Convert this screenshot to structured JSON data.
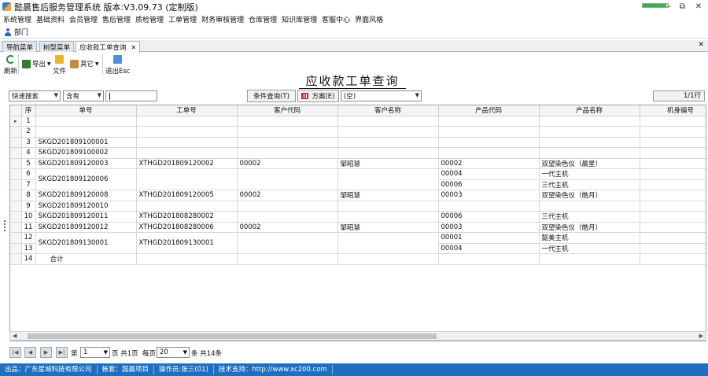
{
  "window": {
    "title": "懿晨售后服务管理系统 版本:V3.09.73 (定制版)",
    "progress": 0.95,
    "controls": {
      "minimize": "–",
      "restore": "⧉",
      "close": "✕"
    }
  },
  "menu": [
    "系统管理",
    "基础资料",
    "会员管理",
    "售后管理",
    "质检管理",
    "工单管理",
    "财务审核管理",
    "仓库管理",
    "知识库管理",
    "客服中心",
    "界面风格"
  ],
  "dept": {
    "label": "部门"
  },
  "tabs": [
    {
      "label": "导航菜单",
      "active": false
    },
    {
      "label": "树型菜单",
      "active": false
    },
    {
      "label": "应收款工单查询",
      "active": true,
      "close": "✕"
    }
  ],
  "panel_close": "✕",
  "toolbar": {
    "refresh": "刷新",
    "export": "导出",
    "file": "文件",
    "other": "其它",
    "exit": "退出Esc"
  },
  "page_title": "应收款工单查询",
  "filter": {
    "search_type": "快速搜索",
    "match": "含有",
    "keyword": "",
    "query_button": "条件查询(T)",
    "plan_button": "方案(E)",
    "plan_value": "(空)",
    "page_count": "1/1行"
  },
  "grid": {
    "columns": [
      "序",
      "单号",
      "工单号",
      "客户代码",
      "客户名称",
      "产品代码",
      "产品名称",
      "机身编号"
    ],
    "rows": [
      {
        "seq": "1",
        "order": "",
        "work": "",
        "cust_code": "",
        "cust_name": "",
        "prod_code": "",
        "prod_name": "",
        "serial": "",
        "current": true
      },
      {
        "seq": "2",
        "order": "",
        "work": "",
        "cust_code": "",
        "cust_name": "",
        "prod_code": "",
        "prod_name": "",
        "serial": ""
      },
      {
        "seq": "3",
        "order": "SKGD201809100001",
        "work": "",
        "cust_code": "",
        "cust_name": "",
        "prod_code": "",
        "prod_name": "",
        "serial": ""
      },
      {
        "seq": "4",
        "order": "SKGD201809100002",
        "work": "",
        "cust_code": "",
        "cust_name": "",
        "prod_code": "",
        "prod_name": "",
        "serial": ""
      },
      {
        "seq": "5",
        "order": "SKGD201809120003",
        "work": "XTHGD201809120002",
        "cust_code": "00002",
        "cust_name": "邹昭慧",
        "prod_code": "00002",
        "prod_name": "双望染色仪（晨星）",
        "serial": ""
      },
      {
        "seq": "6",
        "order": "SKGD201809120006",
        "work": "",
        "cust_code": "",
        "cust_name": "",
        "prod_code": "00004",
        "prod_name": "一代主机",
        "serial": ""
      },
      {
        "seq": "7",
        "order": "",
        "work": "",
        "cust_code": "",
        "cust_name": "",
        "prod_code": "00006",
        "prod_name": "三代主机",
        "serial": ""
      },
      {
        "seq": "8",
        "order": "SKGD201809120008",
        "work": "XTHGD201809120005",
        "cust_code": "00002",
        "cust_name": "邹昭慧",
        "prod_code": "00003",
        "prod_name": "双望染色仪（皓月）",
        "serial": ""
      },
      {
        "seq": "9",
        "order": "SKGD201809120010",
        "work": "",
        "cust_code": "",
        "cust_name": "",
        "prod_code": "",
        "prod_name": "",
        "serial": ""
      },
      {
        "seq": "10",
        "order": "SKGD201809120011",
        "work": "XTHGD201808280002",
        "cust_code": "",
        "cust_name": "",
        "prod_code": "00006",
        "prod_name": "三代主机",
        "serial": ""
      },
      {
        "seq": "11",
        "order": "SKGD201809120012",
        "work": "XTHGD201808280006",
        "cust_code": "00002",
        "cust_name": "邹昭慧",
        "prod_code": "00003",
        "prod_name": "双望染色仪（皓月）",
        "serial": ""
      },
      {
        "seq": "12",
        "order": "SKGD201809130001",
        "work": "XTHGD201809130001",
        "cust_code": "",
        "cust_name": "",
        "prod_code": "00001",
        "prod_name": "懿美主机",
        "serial": ""
      },
      {
        "seq": "13",
        "order": "",
        "work": "",
        "cust_code": "",
        "cust_name": "",
        "prod_code": "00004",
        "prod_name": "一代主机",
        "serial": ""
      },
      {
        "seq": "14",
        "order": "合计",
        "work": "",
        "cust_code": "",
        "cust_name": "",
        "prod_code": "",
        "prod_name": "",
        "serial": ""
      }
    ]
  },
  "pager": {
    "first": "|◀",
    "prev": "◀",
    "next": "▶",
    "last": "▶|",
    "page_prefix": "第",
    "page_value": "1",
    "page_suffix": "页 共1页",
    "per_page_prefix": "每页",
    "per_page_value": "20",
    "total": "条 共14条"
  },
  "status": [
    "出品：广东星城科技有限公司",
    "帐套：懿晨项目",
    "操作员:张三(01)",
    "技术支持：http://www.xc200.com"
  ]
}
